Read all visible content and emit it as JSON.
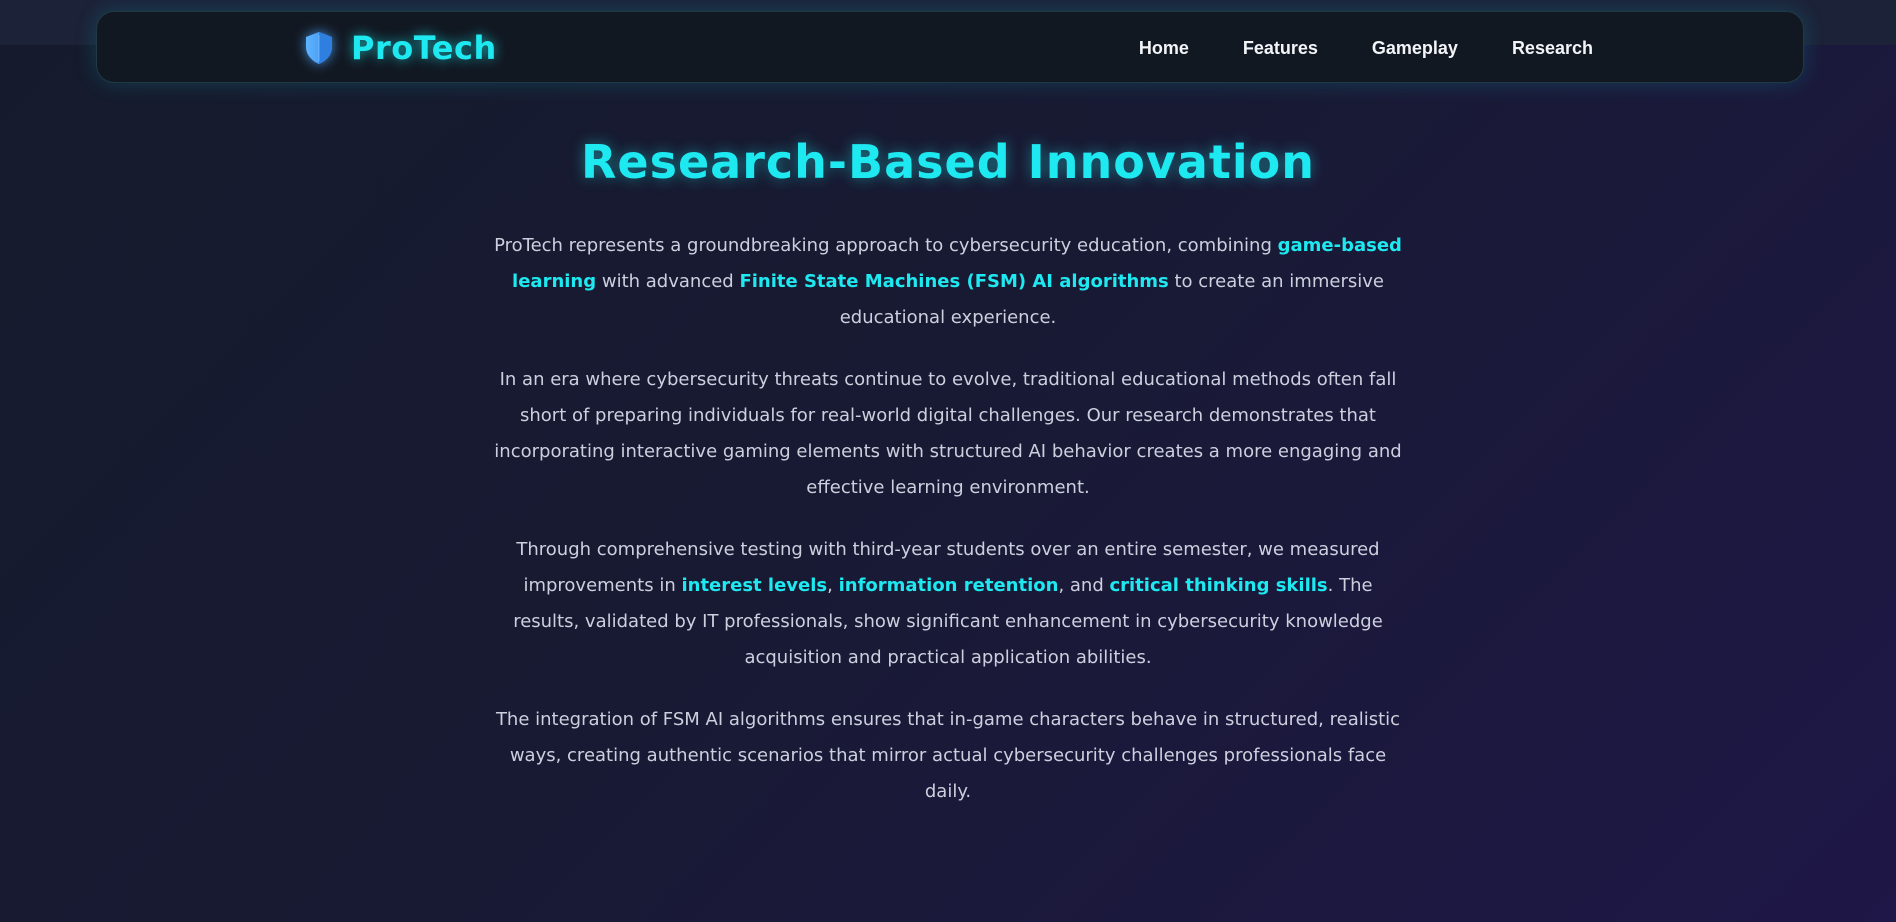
{
  "brand": {
    "name": "ProTech",
    "icon": "shield-icon"
  },
  "nav": {
    "items": [
      "Home",
      "Features",
      "Gameplay",
      "Research"
    ]
  },
  "colors": {
    "accent": "#1ee8f0",
    "nav_bg": "#121822",
    "page_bg_start": "#151b2c",
    "page_bg_end": "#1e1747",
    "text": "#ccd0de"
  },
  "research": {
    "title": "Research-Based Innovation",
    "p1": {
      "t1": "ProTech represents a groundbreaking approach to cybersecurity education, combining ",
      "h1": "game-based learning",
      "t2": " with advanced ",
      "h2": "Finite State Machines (FSM) AI algorithms",
      "t3": " to create an immersive educational experience."
    },
    "p2": "In an era where cybersecurity threats continue to evolve, traditional educational methods often fall short of preparing individuals for real-world digital challenges. Our research demonstrates that incorporating interactive gaming elements with structured AI behavior creates a more engaging and effective learning environment.",
    "p3": {
      "t1": "Through comprehensive testing with third-year students over an entire semester, we measured improvements in ",
      "h1": "interest levels",
      "t2": ", ",
      "h2": "information retention",
      "t3": ", and ",
      "h3": "critical thinking skills",
      "t4": ". The results, validated by IT professionals, show significant enhancement in cybersecurity knowledge acquisition and practical application abilities."
    },
    "p4": "The integration of FSM AI algorithms ensures that in-game characters behave in structured, realistic ways, creating authentic scenarios that mirror actual cybersecurity challenges professionals face daily."
  }
}
